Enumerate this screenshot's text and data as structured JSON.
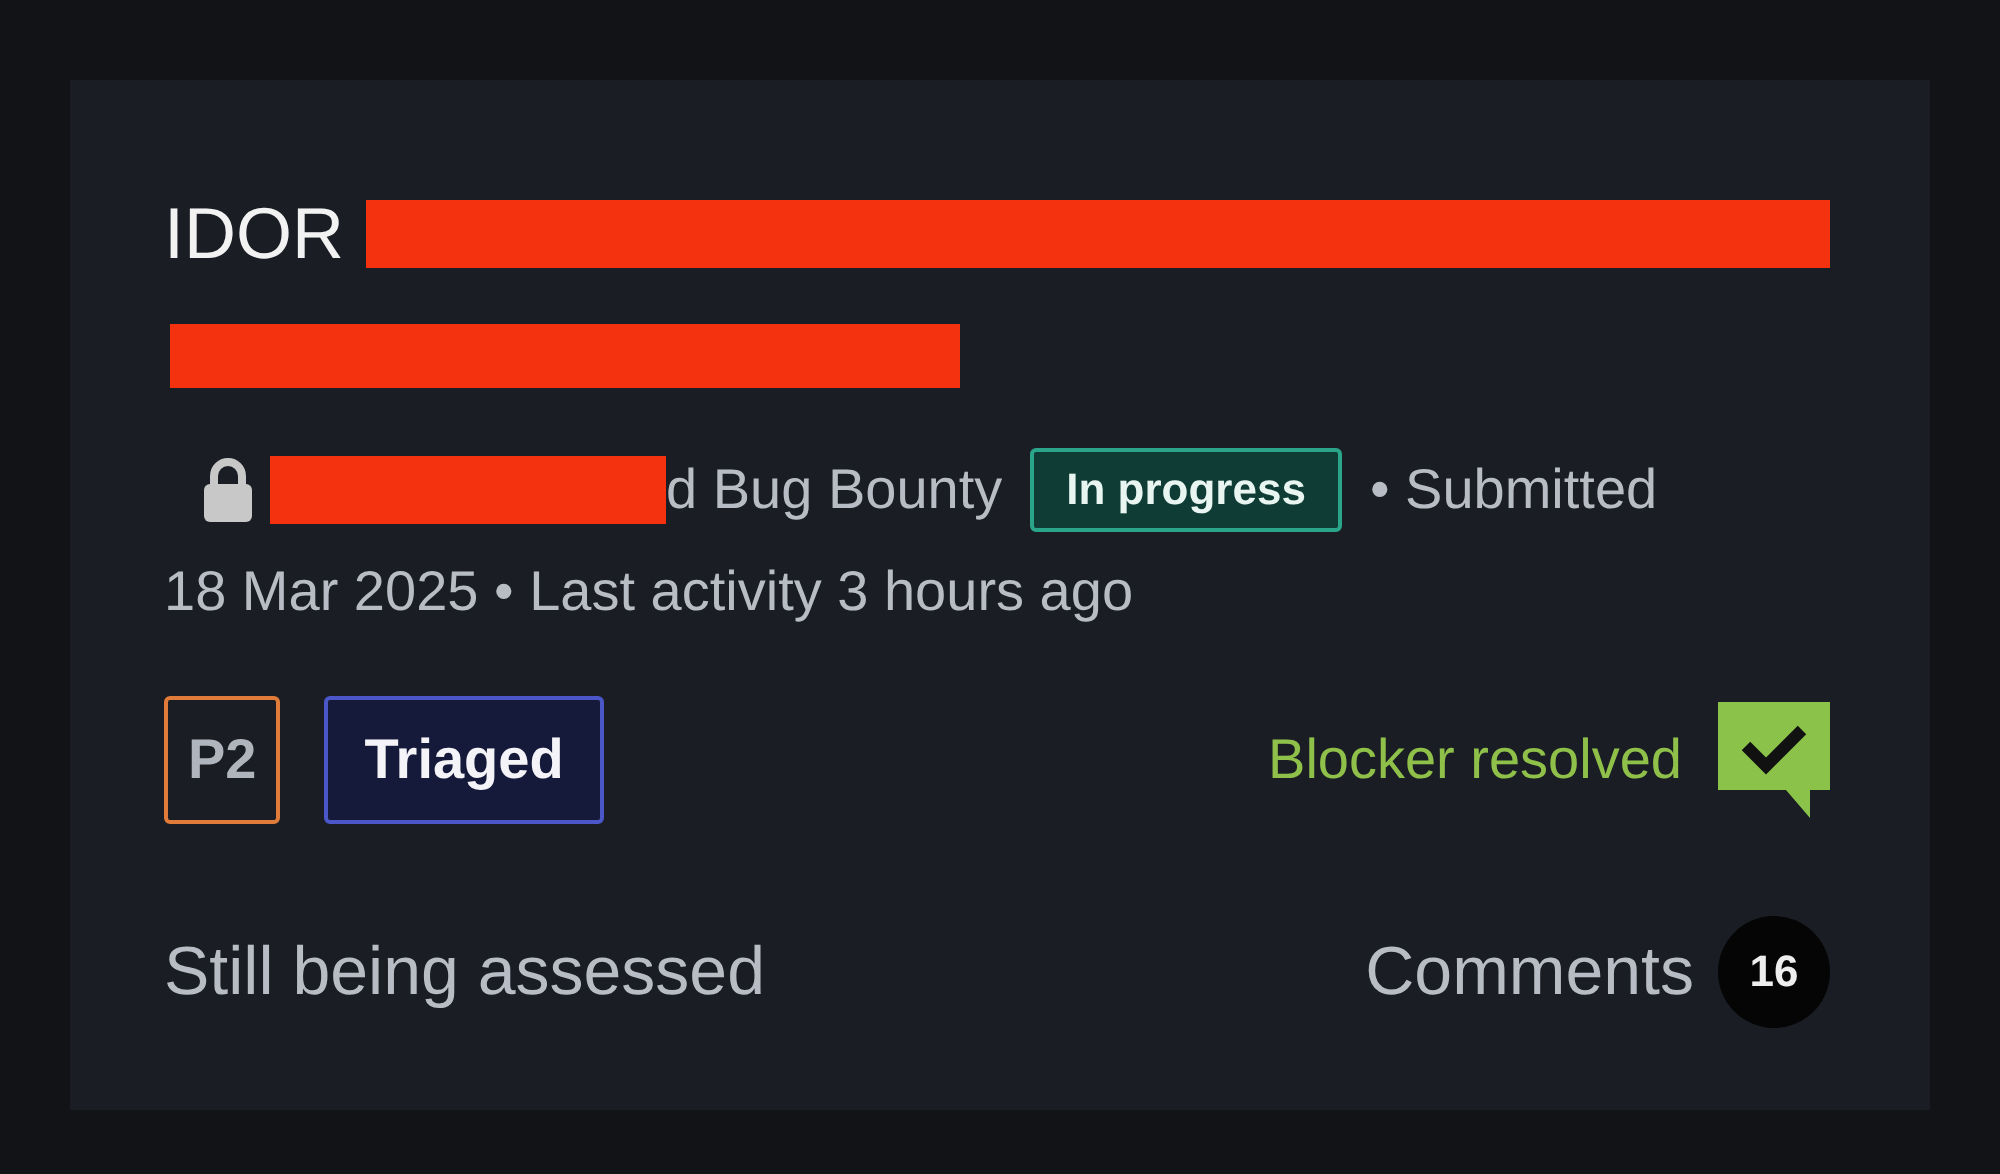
{
  "report": {
    "title": "IDOR",
    "program": "d Bug Bounty",
    "status_badge": "In progress",
    "submitted_label": "• Submitted",
    "date_line": "18 Mar 2025 • Last activity 3 hours ago",
    "priority": "P2",
    "state": "Triaged",
    "blocker": "Blocker resolved",
    "assessment": "Still being assessed",
    "comments_label": "Comments",
    "comments_count": "16"
  }
}
